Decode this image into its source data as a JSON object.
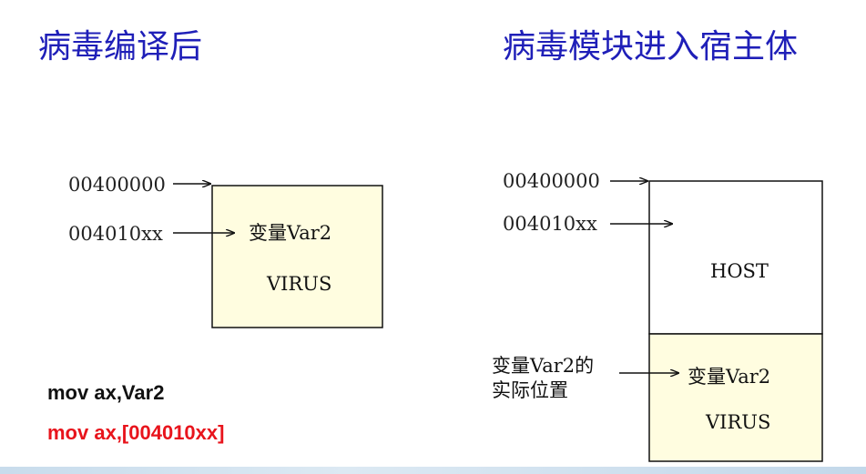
{
  "titles": {
    "left": "病毒编译后",
    "right": "病毒模块进入宿主体"
  },
  "left_panel": {
    "addr_start": "00400000",
    "addr_var": "004010xx",
    "box_var_label": "变量Var2",
    "box_virus_label": "VIRUS"
  },
  "right_panel": {
    "addr_start": "00400000",
    "addr_var": "004010xx",
    "host_label": "HOST",
    "var_label": "变量Var2",
    "virus_label": "VIRUS",
    "actual_location_line1": "变量Var2的",
    "actual_location_line2": "实际位置"
  },
  "code": {
    "line1": "mov ax,Var2",
    "line2": "mov ax,[004010xx]"
  },
  "colors": {
    "title": "#1f1fb8",
    "box_fill": "#fffde0",
    "code_highlight": "#e8141c"
  }
}
